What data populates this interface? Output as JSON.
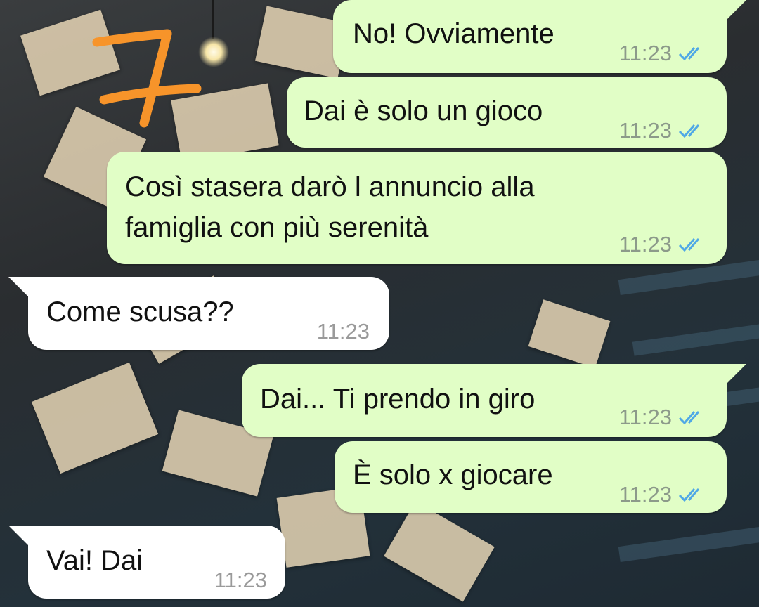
{
  "annotation": {
    "number": "7",
    "color": "#f7942a"
  },
  "colors": {
    "outgoing_bubble": "#e1fec6",
    "incoming_bubble": "#ffffff",
    "read_ticks": "#4fa8e6"
  },
  "messages": [
    {
      "direction": "out",
      "lines": [
        "No! Ovviamente"
      ],
      "time": "11:23",
      "status": "read"
    },
    {
      "direction": "out",
      "lines": [
        "Dai è solo un gioco"
      ],
      "time": "11:23",
      "status": "read"
    },
    {
      "direction": "out",
      "lines": [
        "Così stasera darò l annuncio alla",
        "famiglia con più serenità"
      ],
      "time": "11:23",
      "status": "read"
    },
    {
      "direction": "in",
      "lines": [
        "Come scusa??"
      ],
      "time": "11:23"
    },
    {
      "direction": "out",
      "lines": [
        "Dai... Ti prendo in giro"
      ],
      "time": "11:23",
      "status": "read"
    },
    {
      "direction": "out",
      "lines": [
        "È solo x giocare"
      ],
      "time": "11:23",
      "status": "read"
    },
    {
      "direction": "in",
      "lines": [
        "Vai! Dai"
      ],
      "time": "11:23"
    }
  ]
}
